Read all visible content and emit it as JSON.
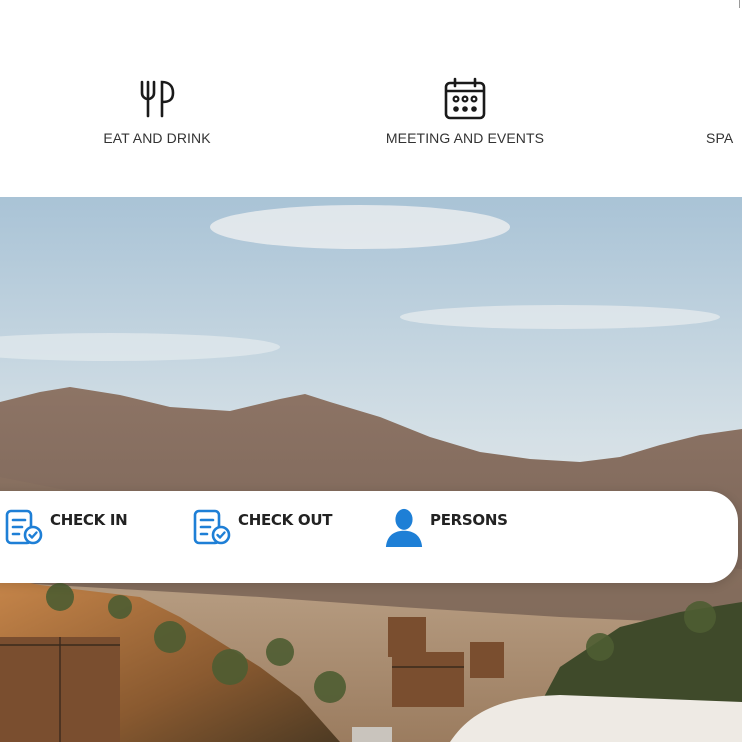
{
  "services": {
    "eat": {
      "label": "EAT AND DRINK",
      "icon": "fork-knife-icon"
    },
    "meetings": {
      "label": "MEETING AND EVENTS",
      "icon": "calendar-icon"
    },
    "spa": {
      "label": "SPA"
    }
  },
  "booking": {
    "check_in": {
      "label": "CHECK IN",
      "icon": "checklist-icon"
    },
    "check_out": {
      "label": "CHECK OUT",
      "icon": "checklist-icon"
    },
    "persons": {
      "label": "PERSONS",
      "icon": "person-icon"
    }
  },
  "colors": {
    "accent_blue": "#1e7fd6",
    "icon_dark": "#1a1a1a",
    "text": "#333333"
  }
}
